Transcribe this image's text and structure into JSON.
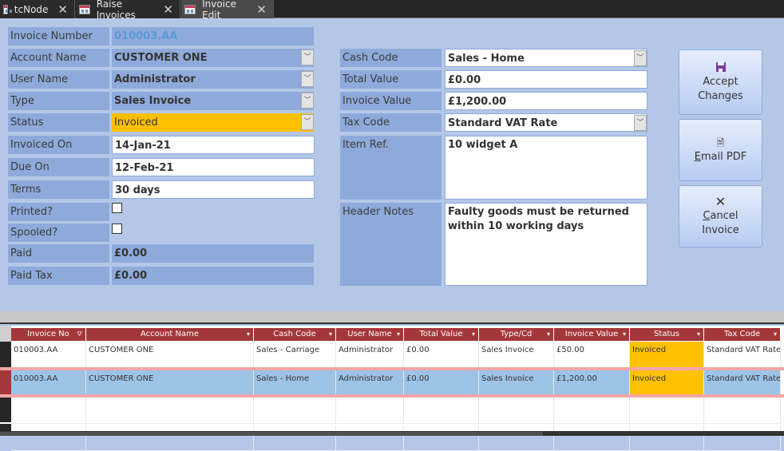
{
  "tabs": [
    {
      "label": "tcNode",
      "active": false
    },
    {
      "label": "Raise Invoices",
      "active": false
    },
    {
      "label": "Invoice Edit",
      "active": true
    }
  ],
  "form": {
    "left": {
      "invoice_number": {
        "label": "Invoice Number",
        "value": "010003.AA"
      },
      "account_name": {
        "label": "Account Name",
        "value": "CUSTOMER ONE"
      },
      "user_name": {
        "label": "User Name",
        "value": "Administrator"
      },
      "type": {
        "label": "Type",
        "value": "Sales Invoice"
      },
      "status": {
        "label": "Status",
        "value": "Invoiced"
      },
      "invoiced_on": {
        "label": "Invoiced On",
        "value": "14-Jan-21"
      },
      "due_on": {
        "label": "Due On",
        "value": "12-Feb-21"
      },
      "terms": {
        "label": "Terms",
        "value": "30 days"
      },
      "printed": {
        "label": "Printed?",
        "checked": false
      },
      "spooled": {
        "label": "Spooled?",
        "checked": false
      },
      "paid": {
        "label": "Paid",
        "value": "£0.00"
      },
      "paid_tax": {
        "label": "Paid Tax",
        "value": "£0.00"
      }
    },
    "right": {
      "cash_code": {
        "label": "Cash Code",
        "value": "Sales - Home"
      },
      "total_value": {
        "label": "Total Value",
        "value": "£0.00"
      },
      "invoice_value": {
        "label": "Invoice Value",
        "value": "£1,200.00"
      },
      "tax_code": {
        "label": "Tax Code",
        "value": "Standard VAT Rate"
      },
      "item_ref": {
        "label": "Item Ref.",
        "value": "10 widget A"
      },
      "header_notes": {
        "label": "Header Notes",
        "value": "Faulty goods must be returned\nwithin 10 working days"
      }
    },
    "buttons": {
      "accept": {
        "line1": "Accept",
        "line2": "Changes",
        "icon": "save-icon"
      },
      "email": {
        "accel": "E",
        "rest": "mail PDF",
        "icon": "pdf-icon"
      },
      "cancel": {
        "accel": "C",
        "rest": "ancel",
        "line2": "Invoice",
        "icon": "close-icon"
      }
    }
  },
  "grid": {
    "columns": [
      "Invoice No",
      "Account Name",
      "Cash Code",
      "User Name",
      "Total Value",
      "Type/Cd",
      "Invoice Value",
      "Status",
      "Tax Code"
    ],
    "rows": [
      [
        "010003.AA",
        "CUSTOMER ONE",
        "Sales - Carriage",
        "Administrator",
        "£0.00",
        "Sales Invoice",
        "£50.00",
        "Invoiced",
        "Standard VAT Rate"
      ],
      [
        "010003.AA",
        "CUSTOMER ONE",
        "Sales - Home",
        "Administrator",
        "£0.00",
        "Sales Invoice",
        "£1,200.00",
        "Invoiced",
        "Standard VAT Rate"
      ]
    ],
    "status_color": "#ffc000",
    "selected_row_color": "#9dc3e6",
    "header_color": "#a4373a"
  }
}
